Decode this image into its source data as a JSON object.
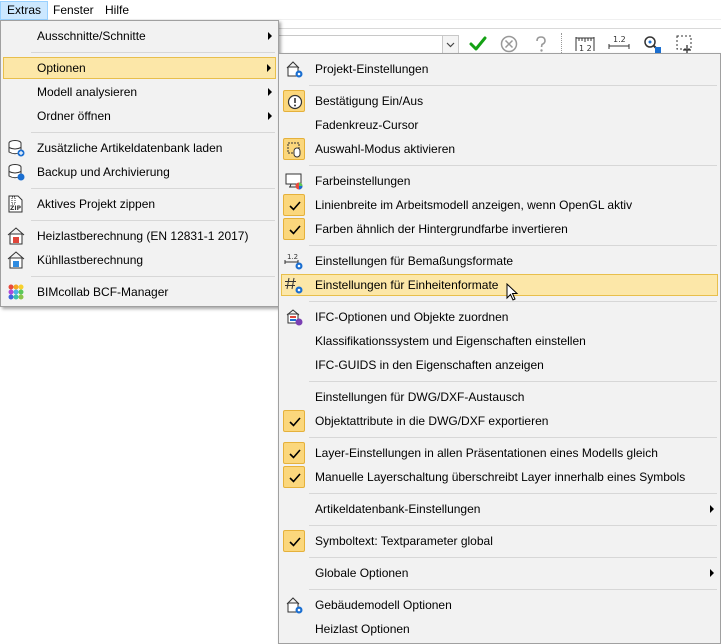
{
  "menubar": [
    "Extras",
    "Fenster",
    "Hilfe"
  ],
  "extras_menu": [
    {
      "label": "Ausschnitte/Schnitte",
      "submenu": true
    },
    {
      "label": "Optionen",
      "submenu": true
    },
    {
      "label": "Modell analysieren",
      "submenu": true
    },
    {
      "label": "Ordner öffnen",
      "submenu": true
    },
    {
      "label": "Zusätzliche Artikeldatenbank laden"
    },
    {
      "label": "Backup und Archivierung"
    },
    {
      "label": "Aktives Projekt zippen"
    },
    {
      "label": "Heizlastberechnung (EN 12831-1 2017)"
    },
    {
      "label": "Kühllastberechnung"
    },
    {
      "label": "BIMcollab BCF-Manager"
    }
  ],
  "optionen_menu": [
    {
      "label": "Projekt-Einstellungen"
    },
    {
      "label": "Bestätigung Ein/Aus"
    },
    {
      "label": "Fadenkreuz-Cursor"
    },
    {
      "label": "Auswahl-Modus aktivieren"
    },
    {
      "label": "Farbeinstellungen"
    },
    {
      "label": "Linienbreite im Arbeitsmodell anzeigen, wenn OpenGL aktiv",
      "checked": true
    },
    {
      "label": "Farben ähnlich der Hintergrundfarbe invertieren",
      "checked": true
    },
    {
      "label": "Einstellungen für Bemaßungsformate"
    },
    {
      "label": "Einstellungen für Einheitenformate"
    },
    {
      "label": "IFC-Optionen und Objekte zuordnen"
    },
    {
      "label": "Klassifikationssystem und Eigenschaften einstellen"
    },
    {
      "label": "IFC-GUIDS in den Eigenschaften anzeigen"
    },
    {
      "label": "Einstellungen für DWG/DXF-Austausch"
    },
    {
      "label": "Objektattribute in die DWG/DXF exportieren",
      "checked": true
    },
    {
      "label": "Layer-Einstellungen in allen Präsentationen eines Modells gleich",
      "checked": true
    },
    {
      "label": "Manuelle Layerschaltung überschreibt Layer innerhalb eines Symbols",
      "checked": true
    },
    {
      "label": "Artikeldatenbank-Einstellungen",
      "submenu": true
    },
    {
      "label": "Symboltext: Textparameter global",
      "checked": true
    },
    {
      "label": "Globale Optionen",
      "submenu": true
    },
    {
      "label": "Gebäudemodell Optionen"
    },
    {
      "label": "Heizlast Optionen"
    }
  ],
  "toolbar": {
    "icons": [
      "confirm-check-icon",
      "cancel-circle-icon",
      "help-question-icon",
      "dimension-icon",
      "dimension-format-icon",
      "snap-icon",
      "select-cursor-icon"
    ],
    "dim_label": "1 2",
    "dim_format_label": "1.2"
  },
  "colors": {
    "highlight_bg": "#fce7a8",
    "highlight_border": "#e8bf4c",
    "menubar_active": "#cce8ff",
    "menu_bg": "#f2f2f2"
  }
}
